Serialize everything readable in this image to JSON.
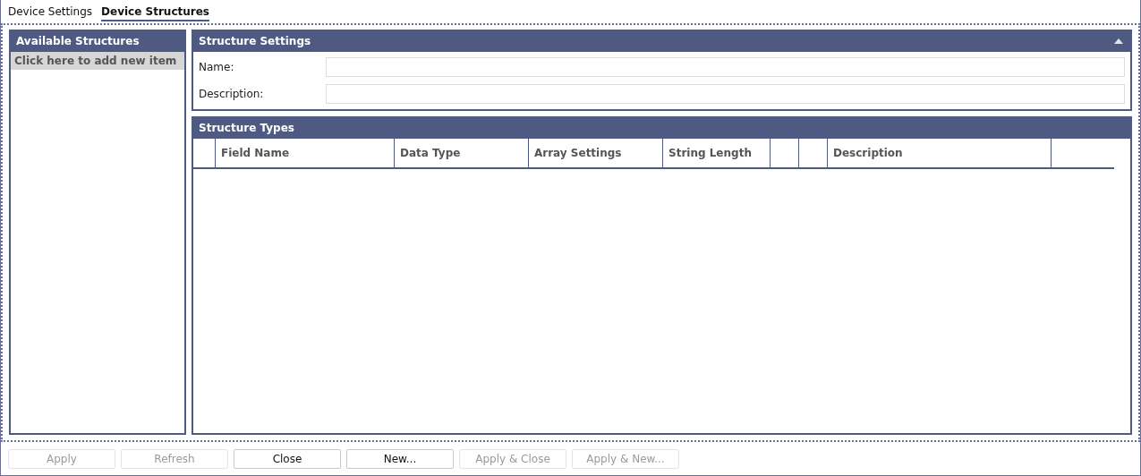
{
  "tabs": [
    {
      "label": "Device Settings",
      "selected": false
    },
    {
      "label": "Device Structures",
      "selected": true
    }
  ],
  "available_structures": {
    "title": "Available Structures",
    "add_item": "Click here to add new item"
  },
  "structure_settings": {
    "title": "Structure Settings",
    "expanded": true,
    "fields": [
      {
        "label": "Name:"
      },
      {
        "label": "Description:"
      }
    ]
  },
  "structure_types": {
    "title": "Structure Types",
    "columns": [
      {
        "kind": "spacer"
      },
      {
        "kind": "label",
        "label": "Field Name"
      },
      {
        "kind": "label",
        "label": "Data Type"
      },
      {
        "kind": "label",
        "label": "Array Settings"
      },
      {
        "kind": "label",
        "label": "String Length"
      },
      {
        "kind": "spacer"
      },
      {
        "kind": "spacer"
      },
      {
        "kind": "label",
        "label": "Description"
      },
      {
        "kind": "spacer"
      }
    ]
  },
  "buttons": [
    {
      "label": "Apply",
      "disabled": true
    },
    {
      "label": "Refresh",
      "disabled": true
    },
    {
      "label": "Close",
      "disabled": false
    },
    {
      "label": "New...",
      "disabled": false
    },
    {
      "label": "Apply & Close",
      "disabled": true
    },
    {
      "label": "Apply & New...",
      "disabled": true
    }
  ]
}
